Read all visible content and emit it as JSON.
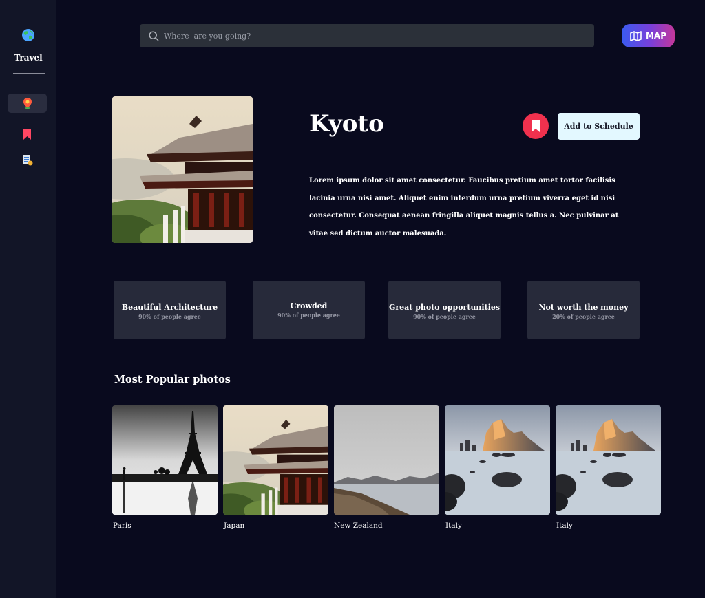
{
  "sidebar": {
    "app_name": "Travel",
    "items": [
      {
        "icon": "location-pin-icon",
        "active": true
      },
      {
        "icon": "bookmark-icon",
        "active": false
      },
      {
        "icon": "schedule-icon",
        "active": false
      }
    ]
  },
  "search": {
    "placeholder": "Where  are you going?"
  },
  "map_button": {
    "label": "MAP"
  },
  "destination": {
    "title": "Kyoto",
    "add_schedule_label": "Add to Schedule",
    "description": "Lorem ipsum dolor sit amet consectetur. Faucibus pretium amet tortor facilisis lacinia urna nisi amet. Aliquet enim interdum urna pretium viverra eget id nisi consectetur. Consequat aenean fringilla aliquet magnis tellus a. Nec pulvinar at vitae sed dictum auctor malesuada."
  },
  "stats": [
    {
      "title": "Beautiful Architecture",
      "subtitle": "90% of people agree"
    },
    {
      "title": "Crowded",
      "subtitle": "90% of people agree"
    },
    {
      "title": "Great photo opportunities",
      "subtitle": "90% of people agree"
    },
    {
      "title": "Not worth the money",
      "subtitle": "20% of people agree"
    }
  ],
  "popular": {
    "title": "Most Popular photos",
    "photos": [
      {
        "label": "Paris"
      },
      {
        "label": "Japan"
      },
      {
        "label": "New Zealand"
      },
      {
        "label": "Italy"
      },
      {
        "label": "Italy"
      }
    ]
  },
  "colors": {
    "background": "#090a1e",
    "sidebar": "#121527",
    "card": "#272a3a",
    "accent_red": "#f0314e",
    "schedule_button": "#e3f8ff"
  }
}
